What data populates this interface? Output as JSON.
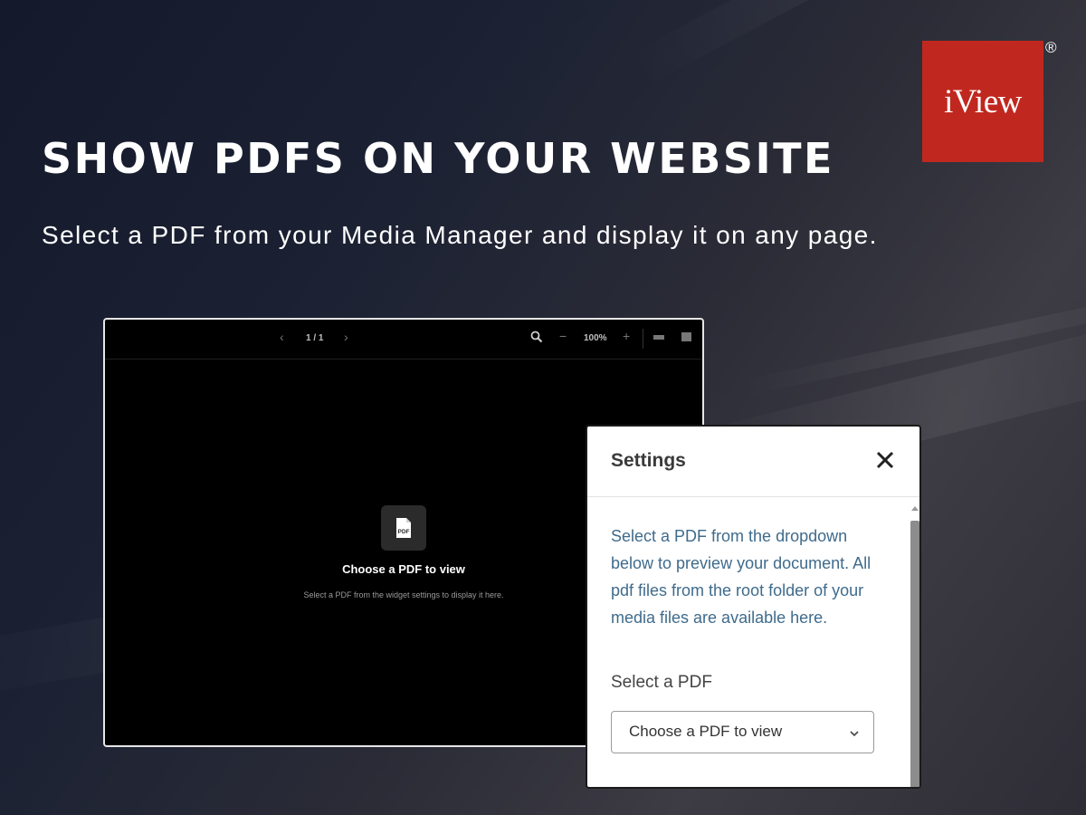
{
  "brand": {
    "logo_text": "iView",
    "registered_mark": "®",
    "logo_color": "#c0281f"
  },
  "hero": {
    "headline": "SHOW PDFS ON YOUR WEBSITE",
    "subline": "Select a PDF from your Media Manager and display it on any page."
  },
  "viewer": {
    "toolbar": {
      "prev_icon": "‹",
      "page_indicator": "1 / 1",
      "next_icon": "›",
      "search_icon": "search-icon",
      "zoom_out_icon": "−",
      "zoom_level": "100%",
      "zoom_in_icon": "+"
    },
    "empty_state": {
      "icon_label": "PDF",
      "title": "Choose a PDF to view",
      "description": "Select a PDF from the widget settings to display it here."
    }
  },
  "settings": {
    "title": "Settings",
    "close_icon": "close-icon",
    "description": "Select a PDF from the dropdown below to preview your document. All pdf files from the root folder of your media files are available here.",
    "select_label": "Select a PDF",
    "select_value": "Choose a PDF to view"
  }
}
